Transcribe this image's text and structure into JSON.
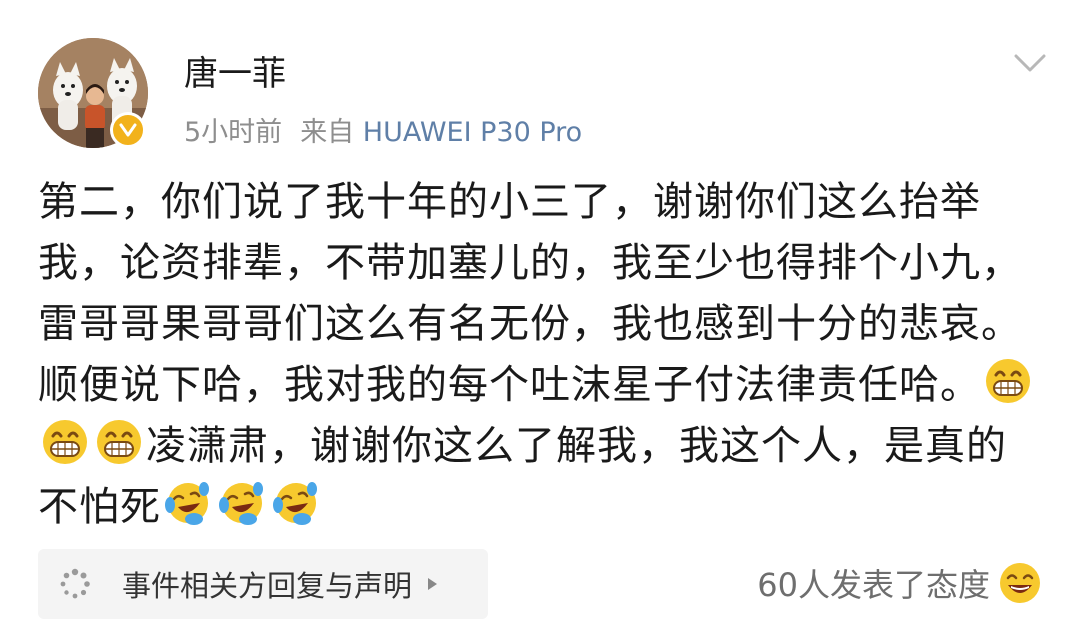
{
  "post": {
    "author": "唐一菲",
    "time": "5小时前",
    "source_prefix": "来自",
    "device": "HUAWEI P30 Pro",
    "text_part1": "第二，你们说了我十年的小三了，谢谢你们这么抬举我，论资排辈，不带加塞儿的，我至少也得排个小九，雷哥哥果哥哥们这么有名无份，我也感到十分的悲哀。顺便说下哈，我对我的每个吐沫星子付法律责任哈。",
    "text_part2": "凌潇肃，谢谢你这么了解我，我这个人，是真的不怕死",
    "inline_emoji_1": "grin-emoji",
    "inline_emoji_2": "laugh-cry-emoji"
  },
  "footer": {
    "reply_label": "事件相关方回复与声明",
    "reaction_count": "60人发表了态度"
  },
  "icons": {
    "verified": "verified-badge-icon",
    "more": "chevron-down-icon",
    "reply": "spinner-icon",
    "reply_arrow": "triangle-right-icon",
    "reaction": "smile-emoji-icon"
  },
  "colors": {
    "device": "#5f7fa7",
    "verified": "#f2b21c",
    "emoji": "#f7c92e"
  }
}
